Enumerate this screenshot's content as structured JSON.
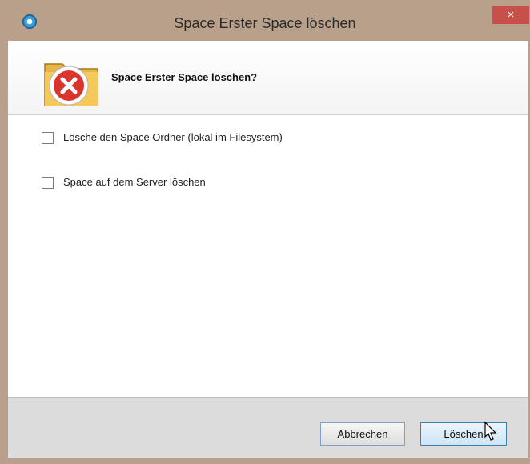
{
  "window": {
    "title": "Space Erster Space löschen",
    "close_glyph": "×"
  },
  "header": {
    "message": "Space Erster Space löschen?",
    "icon": "delete-folder-icon"
  },
  "options": [
    {
      "label": "Lösche den Space Ordner (lokal im Filesystem)",
      "checked": false
    },
    {
      "label": "Space auf dem Server löschen",
      "checked": false
    }
  ],
  "buttons": {
    "cancel_label": "Abbrechen",
    "delete_label": "Löschen"
  },
  "colors": {
    "titlebar": "#b8a08b",
    "close": "#c7504a",
    "error_red": "#d9352c",
    "folder": "#f2c455"
  }
}
